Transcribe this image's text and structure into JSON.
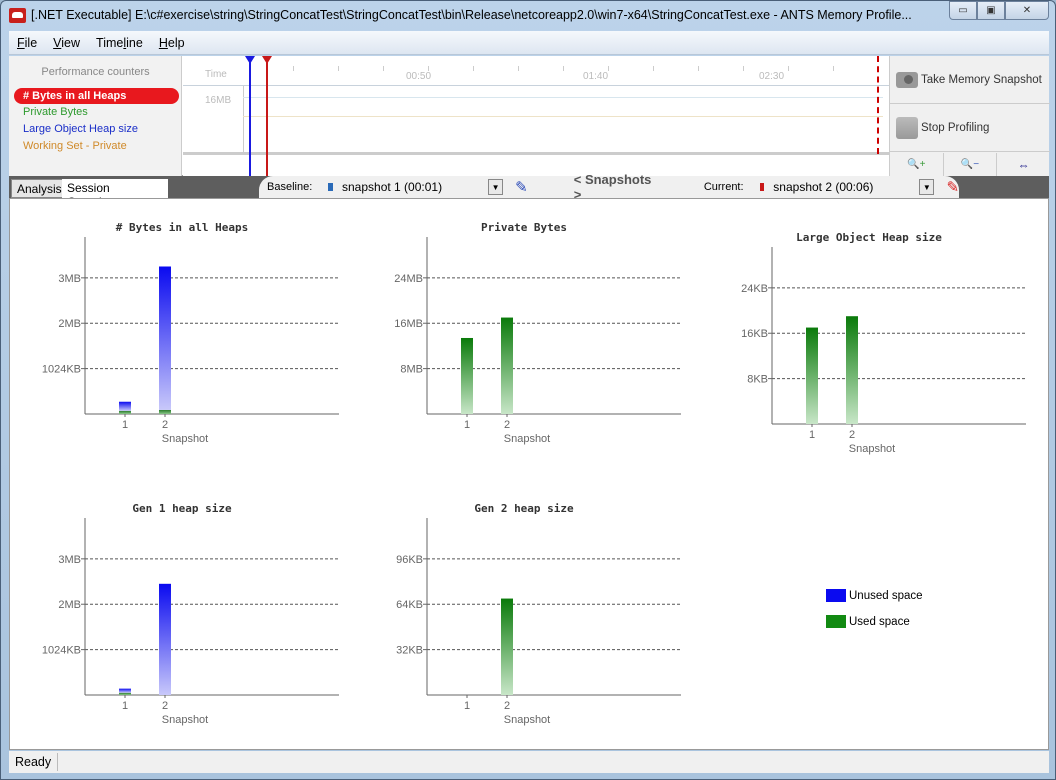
{
  "window": {
    "title": "[.NET Executable] E:\\c#exercise\\string\\StringConcatTest\\StringConcatTest\\bin\\Release\\netcoreapp2.0\\win7-x64\\StringConcatTest.exe - ANTS Memory Profile...",
    "buttons": {
      "minimize": "▭",
      "maximize": "▣",
      "close": "✕"
    }
  },
  "menu": [
    {
      "label": "File",
      "accel": "F",
      "rest": "ile"
    },
    {
      "label": "View",
      "accel": "V",
      "rest": "iew"
    },
    {
      "label": "Timeline",
      "pre": "Time",
      "accel": "l",
      "rest": "ine"
    },
    {
      "label": "Help",
      "accel": "H",
      "rest": "elp"
    }
  ],
  "counters": {
    "title": "Performance counters",
    "items": [
      {
        "label": "# Bytes in all Heaps",
        "color": "#ffffff",
        "selected": true
      },
      {
        "label": "Private Bytes",
        "color": "#2e9a2e"
      },
      {
        "label": "Large Object Heap size",
        "color": "#1a2ec8"
      },
      {
        "label": "Working Set - Private",
        "color": "#d08a2a"
      }
    ]
  },
  "timeline": {
    "time_label": "Time",
    "ticks": [
      "00:50",
      "01:40",
      "02:30"
    ],
    "mb_label": "16MB",
    "baseline_color": "#1a1ae0",
    "current_color": "#c81818"
  },
  "actions": {
    "take_snapshot": "Take Memory Snapshot",
    "stop_profiling": "Stop Profiling",
    "zoom_in": "🔍+",
    "zoom_out": "🔍−",
    "fit": "⇔"
  },
  "tabs": {
    "analysis": "Analysis",
    "session_overview": "Session Overview"
  },
  "snapshots": {
    "baseline_label": "Baseline:",
    "baseline_value": "snapshot 1 (00:01)",
    "baseline_color": "#2a6ab8",
    "nav_label": "< Snapshots >",
    "current_label": "Current:",
    "current_value": "snapshot 2 (00:06)",
    "current_color": "#c81818"
  },
  "legend": [
    {
      "label": "Unused space",
      "color": "#0a0af0"
    },
    {
      "label": "Used space",
      "color": "#128a12"
    }
  ],
  "status": {
    "text": "Ready"
  },
  "chart_data": [
    {
      "type": "bar",
      "title": "# Bytes in all Heaps",
      "xlabel": "Snapshot",
      "categories": [
        "1",
        "2"
      ],
      "unit": "MB",
      "yticks": [
        {
          "v": 1,
          "label": "1024KB"
        },
        {
          "v": 2,
          "label": "2MB"
        },
        {
          "v": 3,
          "label": "3MB"
        }
      ],
      "ylim": [
        0,
        3.9
      ],
      "stacked": true,
      "series": [
        {
          "name": "Used space",
          "color": "green",
          "values": [
            0.07,
            0.09
          ]
        },
        {
          "name": "Unused space",
          "color": "blue",
          "values": [
            0.2,
            3.16
          ]
        }
      ]
    },
    {
      "type": "bar",
      "title": "Private Bytes",
      "xlabel": "Snapshot",
      "categories": [
        "1",
        "2"
      ],
      "unit": "MB",
      "yticks": [
        {
          "v": 8,
          "label": "8MB"
        },
        {
          "v": 16,
          "label": "16MB"
        },
        {
          "v": 24,
          "label": "24MB"
        }
      ],
      "ylim": [
        0,
        31.2
      ],
      "series": [
        {
          "name": "Private Bytes",
          "color": "green",
          "values": [
            13.4,
            17
          ]
        }
      ]
    },
    {
      "type": "bar",
      "title": "Large Object Heap size",
      "xlabel": "Snapshot",
      "categories": [
        "1",
        "2"
      ],
      "unit": "KB",
      "yticks": [
        {
          "v": 8,
          "label": "8KB"
        },
        {
          "v": 16,
          "label": "16KB"
        },
        {
          "v": 24,
          "label": "24KB"
        }
      ],
      "ylim": [
        0,
        31.2
      ],
      "series": [
        {
          "name": "Large Object Heap size",
          "color": "green",
          "values": [
            17,
            19
          ]
        }
      ]
    },
    {
      "type": "bar",
      "title": "Gen 1 heap size",
      "xlabel": "Snapshot",
      "categories": [
        "1",
        "2"
      ],
      "unit": "MB",
      "yticks": [
        {
          "v": 1,
          "label": "1024KB"
        },
        {
          "v": 2,
          "label": "2MB"
        },
        {
          "v": 3,
          "label": "3MB"
        }
      ],
      "ylim": [
        0,
        3.9
      ],
      "stacked": true,
      "series": [
        {
          "name": "Used space",
          "color": "green",
          "values": [
            0.05,
            0
          ]
        },
        {
          "name": "Unused space",
          "color": "blue",
          "values": [
            0.09,
            2.45
          ]
        }
      ]
    },
    {
      "type": "bar",
      "title": "Gen 2 heap size",
      "xlabel": "Snapshot",
      "categories": [
        "1",
        "2"
      ],
      "unit": "KB",
      "yticks": [
        {
          "v": 32,
          "label": "32KB"
        },
        {
          "v": 64,
          "label": "64KB"
        },
        {
          "v": 96,
          "label": "96KB"
        }
      ],
      "ylim": [
        0,
        124.8
      ],
      "series": [
        {
          "name": "Gen 2 heap size",
          "color": "green",
          "values": [
            0,
            68
          ]
        }
      ]
    }
  ]
}
